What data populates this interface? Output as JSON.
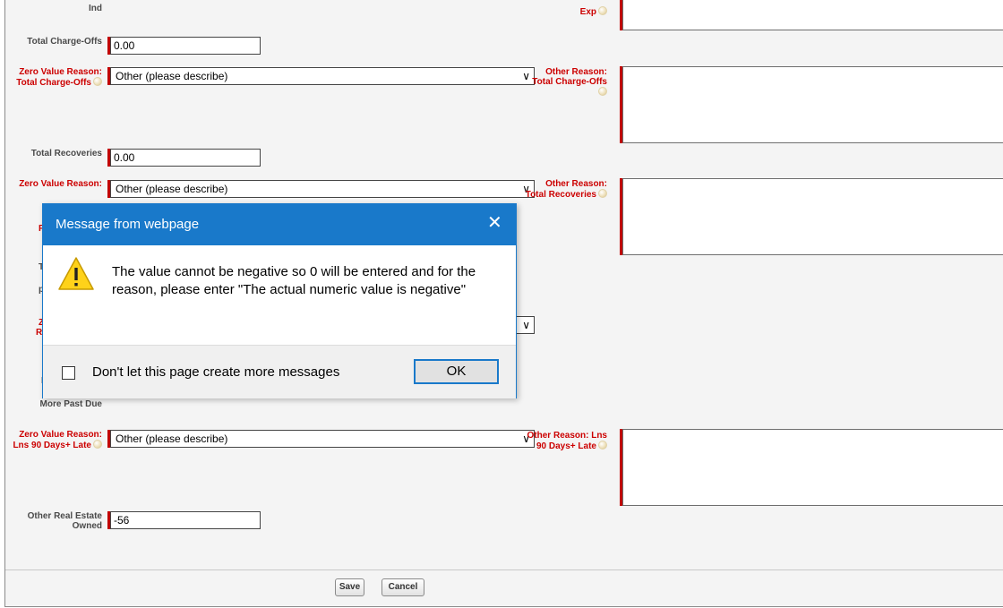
{
  "form": {
    "row0": {
      "left_label": "Ind",
      "right_label": "Exp"
    },
    "charge_offs": {
      "label": "Total Charge-Offs",
      "value": "0.00",
      "zero_reason_label": "Zero Value Reason: Total Charge-Offs",
      "zero_reason_value": "Other (please describe)",
      "other_reason_label": "Other Reason: Total Charge-Offs"
    },
    "recoveries": {
      "label": "Total Recoveries",
      "value": "0.00",
      "zero_reason_label": "Zero Value Reason:",
      "zero_reason_value": "Other (please describe)",
      "other_reason_label": "Other Reason: Total Recoveries"
    },
    "occluded": {
      "a": "Re",
      "b": "To",
      "c": "pe",
      "d": "Ze",
      "e": "Re",
      "f": "L"
    },
    "past_due": {
      "label": "More Past Due"
    },
    "lns90": {
      "zero_reason_label": "Zero Value Reason: Lns 90 Days+ Late",
      "zero_reason_value": "Other (please describe)",
      "other_reason_label": "Other Reason: Lns 90 Days+ Late"
    },
    "oreo": {
      "label": "Other Real Estate Owned",
      "value": "-56"
    }
  },
  "buttons": {
    "save": "Save",
    "cancel": "Cancel"
  },
  "dialog": {
    "title": "Message from webpage",
    "close": "✕",
    "message": "The value cannot be negative so 0 will be entered and for the reason, please enter \"The actual numeric value is negative\"",
    "checkbox_label": "Don't let this page create more messages",
    "ok": "OK",
    "icon": "warning-icon"
  },
  "colors": {
    "required": "#c00000",
    "label_red": "#cc0000",
    "dialog_title": "#1979ca"
  }
}
